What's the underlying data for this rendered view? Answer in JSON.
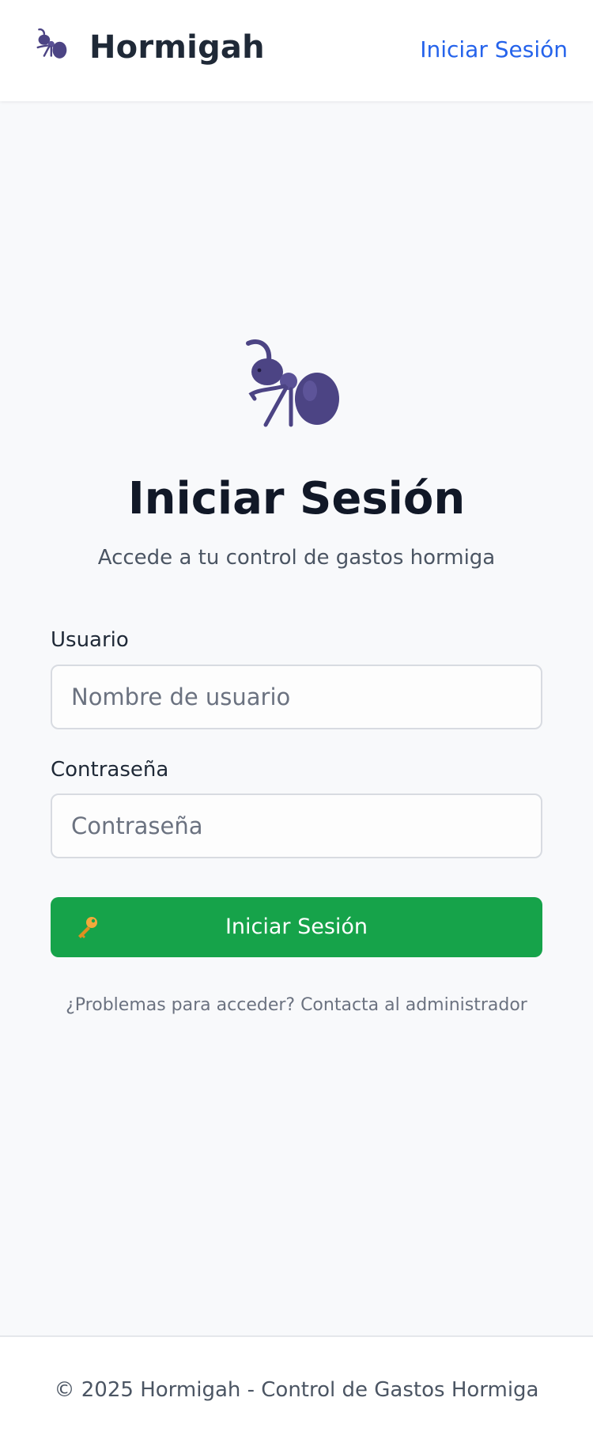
{
  "header": {
    "brand_name": "Hormigah",
    "nav_login": "Iniciar Sesión",
    "logo_icon": "ant-icon"
  },
  "login": {
    "hero_icon": "ant-icon",
    "title": "Iniciar Sesión",
    "subtitle": "Accede a tu control de gastos hormiga",
    "username_label": "Usuario",
    "username_placeholder": "Nombre de usuario",
    "username_value": "",
    "password_label": "Contraseña",
    "password_placeholder": "Contraseña",
    "password_value": "",
    "submit_label": "Iniciar Sesión",
    "submit_icon": "key-icon",
    "help_text": "¿Problemas para acceder? Contacta al administrador"
  },
  "footer": {
    "text": "© 2025 Hormigah - Control de Gastos Hormiga"
  },
  "colors": {
    "primary_link": "#2563eb",
    "button_green": "#16a34a",
    "ant_purple": "#4c4484",
    "key_gold": "#f2a93b"
  }
}
